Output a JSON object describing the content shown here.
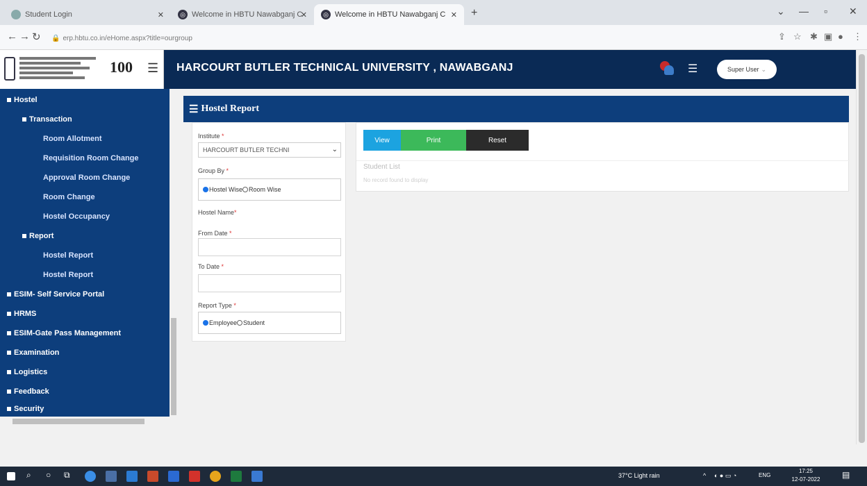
{
  "browser": {
    "tabs": [
      {
        "title": "Student Login"
      },
      {
        "title": "Welcome in HBTU Nawabganj C"
      },
      {
        "title": "Welcome in HBTU Nawabganj C"
      }
    ],
    "url": "erp.hbtu.co.in/eHome.aspx?title=ourgroup"
  },
  "header": {
    "logo_text": "100",
    "title": "HARCOURT BUTLER TECHNICAL UNIVERSITY , NAWABGANJ",
    "user_label": "Super User"
  },
  "sidebar": {
    "items": [
      {
        "label": "Hostel"
      },
      {
        "label": "Transaction"
      },
      {
        "label": "Room Allotment"
      },
      {
        "label": "Requisition Room Change"
      },
      {
        "label": "Approval Room Change"
      },
      {
        "label": "Room Change"
      },
      {
        "label": "Hostel Occupancy"
      },
      {
        "label": "Report"
      },
      {
        "label": "Hostel Report"
      },
      {
        "label": "Hostel Report"
      },
      {
        "label": "ESIM- Self Service Portal"
      },
      {
        "label": "HRMS"
      },
      {
        "label": "ESIM-Gate Pass Management"
      },
      {
        "label": "Examination"
      },
      {
        "label": "Logistics"
      },
      {
        "label": "Feedback"
      },
      {
        "label": "Security"
      }
    ]
  },
  "panel": {
    "title": "Hostel Report"
  },
  "form": {
    "institute_label": "Institute",
    "institute_value": "HARCOURT BUTLER TECHNI",
    "groupby_label": "Group By",
    "groupby_options": [
      "Hostel Wise",
      "Room Wise"
    ],
    "hostel_name_label": "Hostel Name",
    "from_date_label": "From Date",
    "to_date_label": "To Date",
    "report_type_label": "Report Type",
    "report_type_options": [
      "Employee",
      "Student"
    ],
    "required_mark": "*"
  },
  "actions": {
    "view": "View",
    "print": "Print",
    "reset": "Reset",
    "list_title": "Student List",
    "list_empty": "No record found to display"
  },
  "taskbar": {
    "weather": "37°C  Light rain",
    "lang": "ENG",
    "time": "17:25",
    "date": "12-07-2022"
  },
  "colors": {
    "nav": "#0a2a55",
    "sidebar": "#0d3e7c",
    "view_btn": "#1ca3e0",
    "print_btn": "#3cb95a",
    "reset_btn": "#2b2b2b"
  }
}
